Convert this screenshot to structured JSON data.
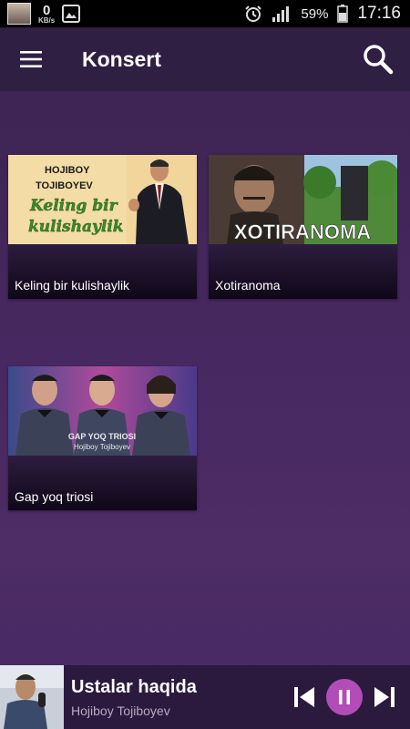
{
  "status_bar": {
    "speed_value": "0",
    "speed_unit": "KB/s",
    "battery": "59%",
    "time": "17:16"
  },
  "app_bar": {
    "title": "Konsert"
  },
  "albums": [
    {
      "title": "Keling bir kulishaylik",
      "thumb_text_1": "HOJIBOY",
      "thumb_text_2": "TOJIBOYEV",
      "thumb_text_3": "Keling bir",
      "thumb_text_4": "kulishaylik"
    },
    {
      "title": "Xotiranoma",
      "thumb_text_1": "XOTIRANOMA"
    },
    {
      "title": "Gap yoq triosi",
      "thumb_text_1": "GAP YOQ TRIOSI",
      "thumb_text_2": "Hojiboy Tojiboyev"
    }
  ],
  "now_playing": {
    "title": "Ustalar haqida",
    "artist": "Hojiboy Tojiboyev"
  },
  "colors": {
    "accent": "#b24db8",
    "app_bar": "#2f1f42",
    "background": "#45275e"
  }
}
